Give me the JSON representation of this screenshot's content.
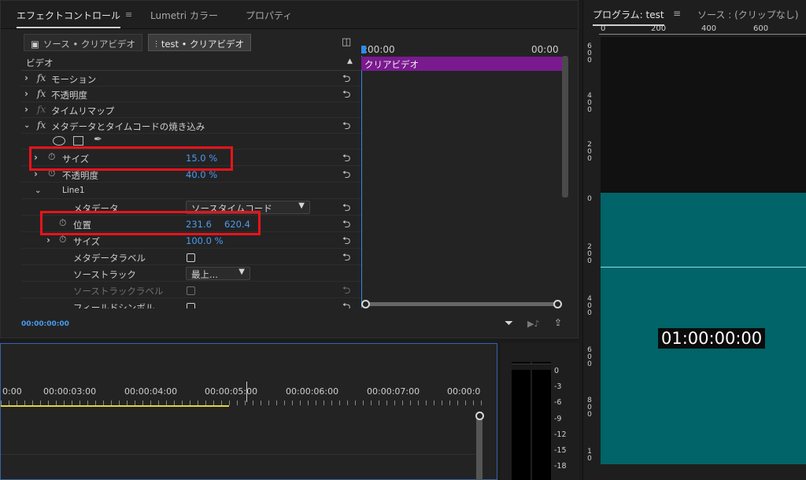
{
  "ec_panel": {
    "tabs": [
      "エフェクトコントロール",
      "Lumetri カラー",
      "プロパティ"
    ],
    "menu_glyph": "≡",
    "source_tab": "ソース • クリアビデオ",
    "sequence_tab": "test • クリアビデオ",
    "section": "ビデオ",
    "rows": {
      "motion": "モーション",
      "opacity": "不透明度",
      "time_remap": "タイムリマップ",
      "burnin": "メタデータとタイムコードの焼き込み",
      "size_label": "サイズ",
      "size_value": "15.0 %",
      "opacity2_label": "不透明度",
      "opacity2_value": "40.0 %",
      "line1": "Line1",
      "metadata_label": "メタデータ",
      "metadata_value": "ソースタイムコード",
      "position_label": "位置",
      "position_x": "231.6",
      "position_y": "620.4",
      "size2_label": "サイズ",
      "size2_value": "100.0 %",
      "metadata_label_label": "メタデータラベル",
      "source_track_label": "ソーストラック",
      "source_track_value": "最上...",
      "source_track_label_label": "ソーストラックラベル",
      "field_symbol_label": "フィールドシンボル"
    },
    "timeline": {
      "ruler_left": ":00:00",
      "ruler_right": "00:00",
      "clip_name": "クリアビデオ"
    },
    "current_time": "00:00:00:00"
  },
  "program": {
    "title": "プログラム: test",
    "menu_glyph": "≡",
    "source_title": "ソース : (クリップなし)",
    "ruler_h": [
      "0",
      "200",
      "400",
      "600"
    ],
    "ruler_v": [
      {
        "c": [
          "6",
          "0",
          "0"
        ]
      },
      {
        "c": [
          "4",
          "0",
          "0"
        ]
      },
      {
        "c": [
          "2",
          "0",
          "0"
        ]
      },
      {
        "c": [
          "0"
        ]
      },
      {
        "c": [
          "2",
          "0",
          "0"
        ]
      },
      {
        "c": [
          "4",
          "0",
          "0"
        ]
      },
      {
        "c": [
          "6",
          "0",
          "0"
        ]
      },
      {
        "c": [
          "8",
          "0",
          "0"
        ]
      },
      {
        "c": [
          "1",
          "0"
        ]
      }
    ],
    "timecode": "01:00:00:00"
  },
  "timeline": {
    "ruler": [
      "0:00",
      "00:00:03:00",
      "00:00:04:00",
      "00:00:05:00",
      "00:00:06:00",
      "00:00:07:00",
      "00:00:0"
    ]
  },
  "meter": {
    "scale": [
      "0",
      "-3",
      "-6",
      "-9",
      "-12",
      "-15",
      "-18"
    ]
  }
}
